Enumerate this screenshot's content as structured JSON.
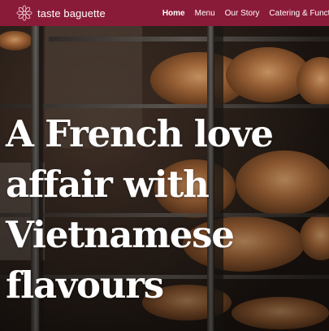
{
  "brand": {
    "name": "taste baguette",
    "logo_icon": "flower-mandala-icon"
  },
  "nav": {
    "items": [
      {
        "label": "Home",
        "active": true
      },
      {
        "label": "Menu",
        "active": false
      },
      {
        "label": "Our Story",
        "active": false
      },
      {
        "label": "Catering & Functions",
        "active": false
      }
    ]
  },
  "hero": {
    "headline_lines": [
      "A French love",
      "affair with",
      "Vietnamese",
      "flavours"
    ],
    "image": "bread-loaves-on-bakery-rack-photo"
  },
  "colors": {
    "nav_background": "#8a1b38",
    "headline_text": "#ffffff",
    "photo_base": "#2a1d16"
  }
}
